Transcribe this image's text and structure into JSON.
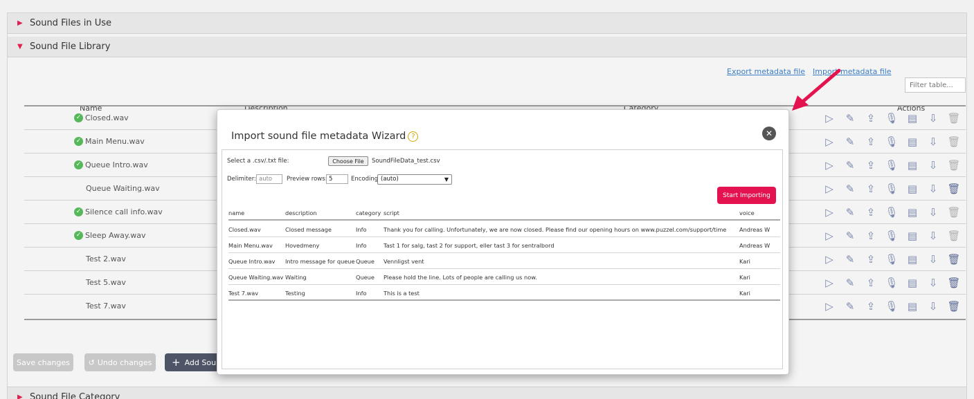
{
  "sections": {
    "in_use": "Sound Files in Use",
    "library": "Sound File Library",
    "category": "Sound File Category"
  },
  "links": {
    "export": "Export metadata file",
    "import": "Import metadata file"
  },
  "filter_placeholder": "Filter table...",
  "table": {
    "headers": {
      "name": "Name",
      "description": "Description",
      "category": "Category",
      "actions": "Actions"
    },
    "rows": [
      {
        "name": "Closed.wav",
        "ok": true
      },
      {
        "name": "Main Menu.wav",
        "ok": true
      },
      {
        "name": "Queue Intro.wav",
        "ok": true
      },
      {
        "name": "Queue Waiting.wav",
        "ok": false
      },
      {
        "name": "Silence call info.wav",
        "ok": true
      },
      {
        "name": "Sleep Away.wav",
        "ok": true
      },
      {
        "name": "Test 2.wav",
        "ok": false
      },
      {
        "name": "Test 5.wav",
        "ok": false
      },
      {
        "name": "Test 7.wav",
        "ok": false
      }
    ]
  },
  "buttons": {
    "save": "Save changes",
    "undo": "Undo changes",
    "add": "Add Sour"
  },
  "modal": {
    "title": "Import sound file metadata Wizard",
    "select_label": "Select a .csv/.txt file:",
    "choose_file": "Choose File",
    "file_name": "SoundFileData_test.csv",
    "delimiter_label": "Delimiter:",
    "delimiter_value": "auto",
    "preview_label": "Preview rows:",
    "preview_value": "5",
    "encoding_label": "Encoding",
    "encoding_value": "(auto)",
    "start_button": "Start Importing",
    "columns": [
      "name",
      "description",
      "category",
      "script",
      "voice"
    ],
    "rows": [
      [
        "Closed.wav",
        "Closed message",
        "Info",
        "Thank you for calling. Unfortunately, we are now closed. Please find our opening hours on www.puzzel.com/support/time",
        "Andreas W"
      ],
      [
        "Main Menu.wav",
        "Hovedmeny",
        "Info",
        "Tast 1 for salg, tast 2 for support, eller tast 3 for sentralbord",
        "Andreas W"
      ],
      [
        "Queue Intro.wav",
        "Intro message for queue x",
        "Queue",
        "Vennligst vent",
        "Kari"
      ],
      [
        "Queue Waiting.wav",
        "Waiting",
        "Queue",
        "Please hold the line. Lots of people are calling us now.",
        "Kari"
      ],
      [
        "Test 7.wav",
        "Testing",
        "Info",
        "This is a test",
        "Kari"
      ]
    ]
  },
  "colors": {
    "accent": "#e4134f",
    "ok": "#56b85a",
    "link": "#3b7dc4",
    "action_icon": "#7a88ad"
  }
}
